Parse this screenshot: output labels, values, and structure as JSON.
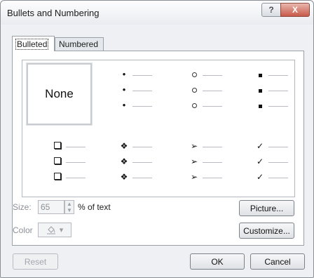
{
  "window": {
    "title": "Bullets and Numbering",
    "help_glyph": "?",
    "close_glyph": "X"
  },
  "tabs": [
    {
      "label": "Bulleted",
      "active": true
    },
    {
      "label": "Numbered",
      "active": false
    }
  ],
  "gallery": {
    "none_label": "None",
    "row1": [
      {
        "icon": "small-dot-bullet",
        "glyph": "•"
      },
      {
        "icon": "hollow-circle-bullet",
        "glyph": ""
      },
      {
        "icon": "small-square-bullet",
        "glyph": ""
      }
    ],
    "row2": [
      {
        "icon": "hollow-square-bullet",
        "glyph": ""
      },
      {
        "icon": "four-diamond-bullet",
        "glyph": "❖"
      },
      {
        "icon": "arrowhead-bullet",
        "glyph": "➢"
      },
      {
        "icon": "check-mark-bullet",
        "glyph": "✓"
      }
    ]
  },
  "size": {
    "label": "Size:",
    "value": "65",
    "unit_label": "% of text"
  },
  "color": {
    "label": "Color",
    "swatch_icon": "paint-bucket-icon",
    "arrow_glyph": "▾"
  },
  "buttons": {
    "picture": "Picture...",
    "customize": "Customize...",
    "reset": "Reset",
    "ok": "OK",
    "cancel": "Cancel"
  }
}
